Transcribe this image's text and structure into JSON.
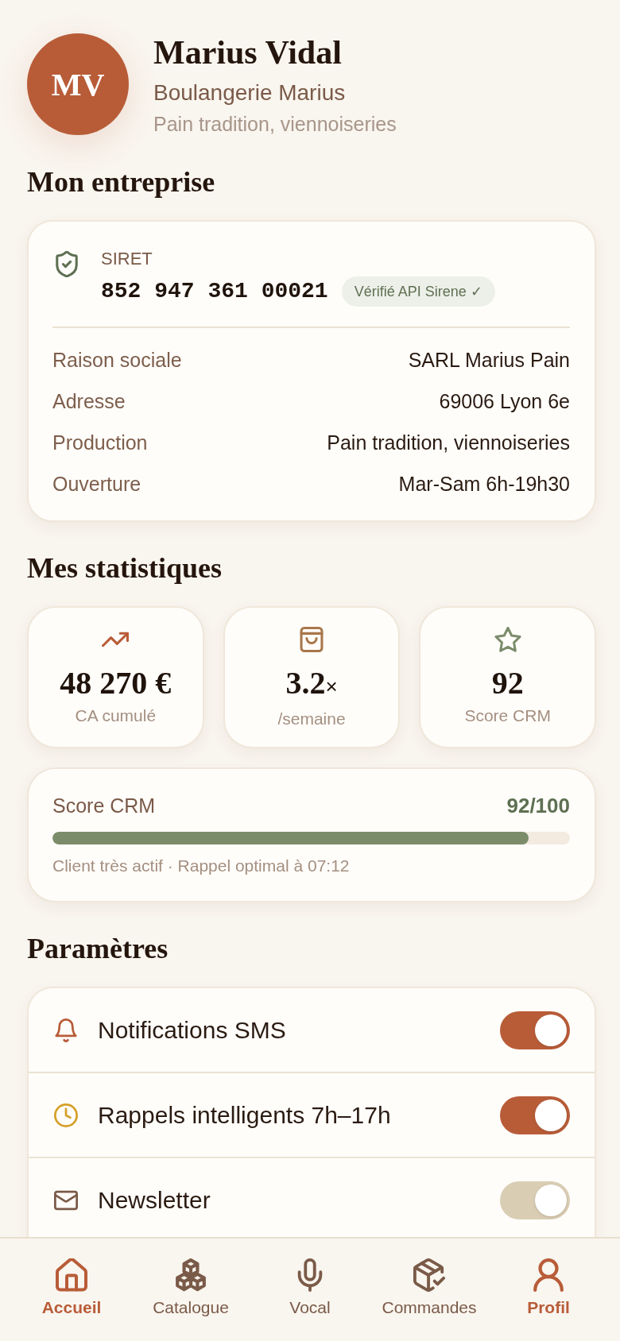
{
  "profile": {
    "initials": "MV",
    "name": "Marius Vidal",
    "business": "Boulangerie Marius",
    "specialty": "Pain tradition, viennoiseries"
  },
  "company": {
    "title": "Mon entreprise",
    "siret_label": "SIRET",
    "siret": "852 947 361 00021",
    "badge": "Vérifié API Sirene ✓",
    "details": [
      {
        "label": "Raison sociale",
        "value": "SARL Marius Pain"
      },
      {
        "label": "Adresse",
        "value": "69006 Lyon 6e"
      },
      {
        "label": "Production",
        "value": "Pain tradition, viennoiseries"
      },
      {
        "label": "Ouverture",
        "value": "Mar-Sam 6h-19h30"
      }
    ]
  },
  "statistics": {
    "title": "Mes statistiques",
    "cards": [
      {
        "value": "48 270 €",
        "label": "CA cumulé"
      },
      {
        "value": "3.2",
        "suffix": "×",
        "label": "/semaine"
      },
      {
        "value": "92",
        "label": "Score CRM"
      }
    ],
    "score": {
      "label": "Score CRM",
      "reading": "92/100",
      "level": 0.92,
      "note": "Client très actif · Rappel optimal à 07:12"
    }
  },
  "settings": {
    "title": "Paramètres",
    "items": [
      {
        "label": "Notifications SMS",
        "on": true
      },
      {
        "label": "Rappels intelligents 7h–17h",
        "on": true
      },
      {
        "label": "Newsletter",
        "on": false
      }
    ]
  },
  "nav": [
    {
      "label": "Accueil",
      "selected": true
    },
    {
      "label": "Catalogue",
      "selected": false
    },
    {
      "label": "Vocal",
      "selected": false
    },
    {
      "label": "Commandes",
      "selected": false
    },
    {
      "label": "Profil",
      "selected": true
    }
  ]
}
